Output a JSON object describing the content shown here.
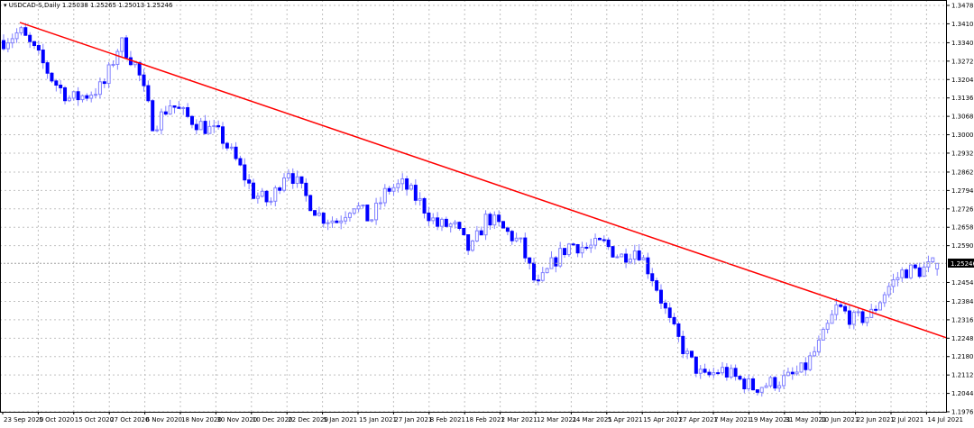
{
  "chart_data": {
    "type": "candlestick",
    "symbol_header": "USDCAD-S,Daily",
    "ohlc_header": [
      "1.25038",
      "1.25265",
      "1.25013",
      "1.25246"
    ],
    "current_price": "1.25246",
    "ylim": [
      1.1976,
      1.3478
    ],
    "y_ticks": [
      "1.34780",
      "1.34100",
      "1.33400",
      "1.32720",
      "1.32040",
      "1.31360",
      "1.30680",
      "1.30000",
      "1.29320",
      "1.28620",
      "1.27940",
      "1.27260",
      "1.26580",
      "1.25900",
      "1.24540",
      "1.23840",
      "1.23160",
      "1.22480",
      "1.21800",
      "1.21120",
      "1.20440",
      "1.19760"
    ],
    "x_ticks": [
      "23 Sep 2020",
      "5 Oct 2020",
      "15 Oct 2020",
      "27 Oct 2020",
      "6 Nov 2020",
      "18 Nov 2020",
      "30 Nov 2020",
      "10 Dec 2020",
      "22 Dec 2020",
      "5 Jan 2021",
      "15 Jan 2021",
      "27 Jan 2021",
      "8 Feb 2021",
      "18 Feb 2021",
      "2 Mar 2021",
      "12 Mar 2021",
      "24 Mar 2021",
      "5 Apr 2021",
      "15 Apr 2021",
      "27 Apr 2021",
      "7 May 2021",
      "19 May 2021",
      "31 May 2021",
      "10 Jun 2021",
      "22 Jun 2021",
      "2 Jul 2021",
      "14 Jul 2021"
    ],
    "close_path": [
      1.3348,
      1.3381,
      1.3298,
      1.3198,
      1.3131,
      1.3148,
      1.3181,
      1.3345,
      1.3248,
      1.3031,
      1.3115,
      1.3065,
      1.3031,
      1.2998,
      1.2898,
      1.2781,
      1.2748,
      1.2881,
      1.2781,
      1.2698,
      1.2681,
      1.2748,
      1.2681,
      1.2798,
      1.2815,
      1.2748,
      1.2665,
      1.2665,
      1.2566,
      1.2698,
      1.2648,
      1.2598,
      1.2432,
      1.2532,
      1.2598,
      1.2581,
      1.2598,
      1.2548,
      1.2581,
      1.2465,
      1.2299,
      1.2182,
      1.2098,
      1.2132,
      1.2098,
      1.2065,
      1.2082,
      1.2098,
      1.2132,
      1.2232,
      1.2365,
      1.2315,
      1.2332,
      1.2432,
      1.2498,
      1.2498,
      1.2525
    ],
    "trendline": {
      "color": "#ff0000",
      "start_price": 1.3415,
      "end_price": 1.2249
    },
    "colors": {
      "bull": "#0000ff",
      "bear": "#0000ff",
      "wick_light": "#8080ff",
      "grid": "#c0c0c0",
      "price_line": "#a0a0a0"
    }
  }
}
